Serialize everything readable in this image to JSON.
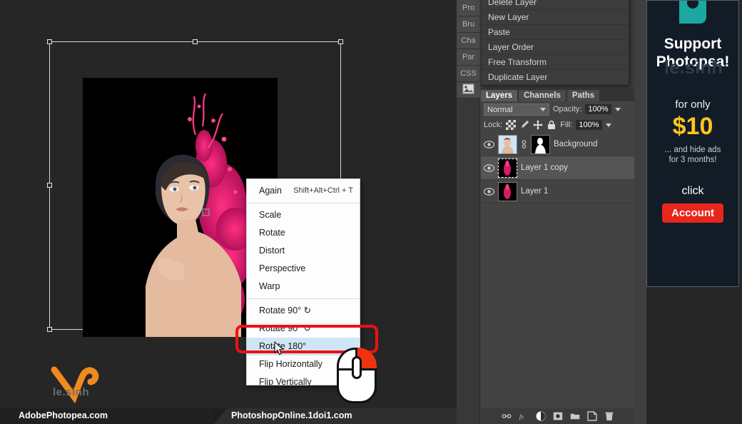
{
  "app": {
    "name": "Photopea"
  },
  "canvas": {
    "artwork_alt": "woman portrait with pink paint splash on black background",
    "watermark": {
      "text": "le.sinh",
      "logo": "v-swoosh-icon",
      "color": "#f08a1e"
    }
  },
  "context_menu": {
    "items": [
      {
        "label": "Again",
        "shortcut": "Shift+Alt+Ctrl + T",
        "highlighted": false,
        "separator_after": true
      },
      {
        "label": "Scale",
        "shortcut": "",
        "highlighted": false
      },
      {
        "label": "Rotate",
        "shortcut": "",
        "highlighted": false
      },
      {
        "label": "Distort",
        "shortcut": "",
        "highlighted": false
      },
      {
        "label": "Perspective",
        "shortcut": "",
        "highlighted": false
      },
      {
        "label": "Warp",
        "shortcut": "",
        "highlighted": false,
        "separator_after": true
      },
      {
        "label": "Rotate 90° ↻",
        "shortcut": "",
        "highlighted": false
      },
      {
        "label": "Rotate 90° ↺",
        "shortcut": "",
        "highlighted": false
      },
      {
        "label": "Rotate 180°",
        "shortcut": "",
        "highlighted": true
      },
      {
        "label": "Flip Horizontally",
        "shortcut": "",
        "highlighted": false
      },
      {
        "label": "Flip Vertically",
        "shortcut": "",
        "highlighted": false
      }
    ],
    "highlight_color": "#ee1111"
  },
  "panel_menu": {
    "items": [
      "Delete Layer",
      "New Layer",
      "Paste",
      "Layer Order",
      "Free Transform",
      "Duplicate Layer"
    ]
  },
  "tab_strip": {
    "tabs": [
      "Pro",
      "Bru",
      "Cha",
      "Par",
      "CSS"
    ],
    "image_tab_icon": "image-icon"
  },
  "layers_panel": {
    "tabs": [
      {
        "label": "Layers",
        "active": true
      },
      {
        "label": "Channels",
        "active": false
      },
      {
        "label": "Paths",
        "active": false
      }
    ],
    "blend_mode": "Normal",
    "opacity_label": "Opacity:",
    "opacity_value": "100%",
    "lock_label": "Lock:",
    "lock_icons": [
      "checkerboard-icon",
      "brush-icon",
      "move-icon",
      "lock-icon"
    ],
    "fill_label": "Fill:",
    "fill_value": "100%",
    "layers": [
      {
        "name": "Background",
        "visible": true,
        "selected": false,
        "has_mask": true
      },
      {
        "name": "Layer 1 copy",
        "visible": true,
        "selected": true,
        "has_mask": false
      },
      {
        "name": "Layer 1",
        "visible": true,
        "selected": false,
        "has_mask": false
      }
    ],
    "bottom_icons": [
      "link-icon",
      "fx-icon",
      "adjustment-icon",
      "mask-icon",
      "folder-icon",
      "new-layer-icon",
      "trash-icon"
    ]
  },
  "ad": {
    "logo": "photopea-logo-icon",
    "title_line1": "Support",
    "title_line2": "Photopea!",
    "for_only": "for only",
    "price": "$10",
    "sub_line1": "... and hide ads",
    "sub_line2": "for 3 months!",
    "click": "click",
    "button": "Account",
    "ghost_text": "le.sinh",
    "accent": "#ffc61a",
    "button_color": "#e8261c"
  },
  "bottom_bar": {
    "left_text": "AdobePhotopea.com",
    "right_text": "PhotoshopOnline.1doi1.com"
  },
  "mouse_hint": {
    "name": "right-click-mouse-icon",
    "highlight": "#f0330f"
  }
}
